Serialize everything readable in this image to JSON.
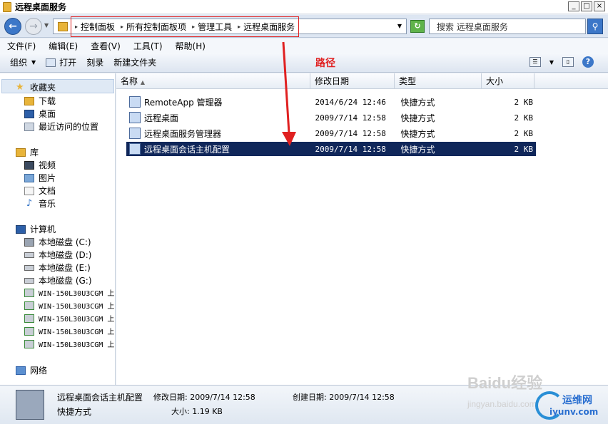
{
  "window": {
    "title": "远程桌面服务",
    "controls": [
      "_",
      "□",
      "×"
    ]
  },
  "nav": {
    "breadcrumbs": [
      "控制面板",
      "所有控制面板项",
      "管理工具",
      "远程桌面服务"
    ],
    "search_placeholder": "搜索 远程桌面服务"
  },
  "menu": [
    "文件(F)",
    "编辑(E)",
    "查看(V)",
    "工具(T)",
    "帮助(H)"
  ],
  "toolbar": {
    "organize": "组织",
    "open": "打开",
    "burn": "刻录",
    "new_folder": "新建文件夹"
  },
  "annotation": {
    "path_label": "路径",
    "color": "#e02020"
  },
  "sidebar": {
    "favorites": {
      "label": "收藏夹",
      "items": [
        "下载",
        "桌面",
        "最近访问的位置"
      ]
    },
    "libraries": {
      "label": "库",
      "items": [
        "视频",
        "图片",
        "文档",
        "音乐"
      ]
    },
    "computer": {
      "label": "计算机",
      "items": [
        "本地磁盘 (C:)",
        "本地磁盘 (D:)",
        "本地磁盘 (E:)",
        "本地磁盘 (G:)",
        "WIN-150L30U3CGM 上",
        "WIN-150L30U3CGM 上",
        "WIN-150L30U3CGM 上",
        "WIN-150L30U3CGM 上",
        "WIN-150L30U3CGM 上"
      ]
    },
    "network": {
      "label": "网络"
    }
  },
  "columns": [
    "名称",
    "修改日期",
    "类型",
    "大小"
  ],
  "files": [
    {
      "name": "RemoteApp 管理器",
      "date": "2014/6/24 12:46",
      "type": "快捷方式",
      "size": "2 KB"
    },
    {
      "name": "远程桌面",
      "date": "2009/7/14 12:58",
      "type": "快捷方式",
      "size": "2 KB"
    },
    {
      "name": "远程桌面服务管理器",
      "date": "2009/7/14 12:58",
      "type": "快捷方式",
      "size": "2 KB"
    },
    {
      "name": "远程桌面会话主机配置",
      "date": "2009/7/14 12:58",
      "type": "快捷方式",
      "size": "2 KB",
      "selected": true
    }
  ],
  "details": {
    "name": "远程桌面会话主机配置",
    "modified": "修改日期: 2009/7/14 12:58",
    "type": "快捷方式",
    "size": "大小: 1.19 KB",
    "created": "创建日期: 2009/7/14 12:58"
  },
  "watermarks": {
    "baidu": "Baidu经验",
    "baidu_url": "jingyan.baidu.com",
    "site_name": "运维网",
    "site_url": "iyunv.com"
  }
}
